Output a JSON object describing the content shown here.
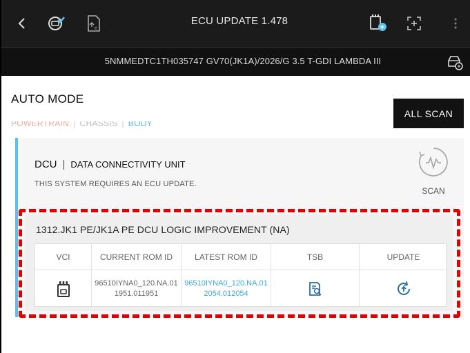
{
  "appbar": {
    "title": "ECU UPDATE 1.478",
    "icons": [
      "back-chevron-icon",
      "vehicle-check-icon",
      "document-export-icon",
      "vci-connect-icon",
      "expand-icon",
      "more-vertical-icon"
    ]
  },
  "vehicle": {
    "info": "5NMMEDTC1TH035747  GV70(JK1A)/2026/G 3.5 T-GDI LAMBDA III"
  },
  "mode": {
    "title": "AUTO MODE",
    "filters": [
      "POWERTRAIN",
      "CHASSIS",
      "BODY"
    ],
    "all_scan_label": "ALL SCAN"
  },
  "system": {
    "code": "DCU",
    "separator": "|",
    "name": "DATA CONNECTIVITY UNIT",
    "message": "THIS SYSTEM REQUIRES AN ECU UPDATE.",
    "scan_label": "SCAN"
  },
  "update": {
    "title": "1312.JK1 PE/JK1A PE DCU LOGIC IMPROVEMENT (NA)",
    "columns": [
      "VCI",
      "CURRENT ROM ID",
      "LATEST ROM ID",
      "TSB",
      "UPDATE"
    ],
    "row": {
      "current_rom": "96510IYNA0_120.NA.011951.011951",
      "latest_rom": "96510IYNA0_120.NA.012054.012054"
    }
  },
  "colors": {
    "accent": "#5ec0e8",
    "highlight": "#e00000",
    "link": "#3aa8dc"
  }
}
